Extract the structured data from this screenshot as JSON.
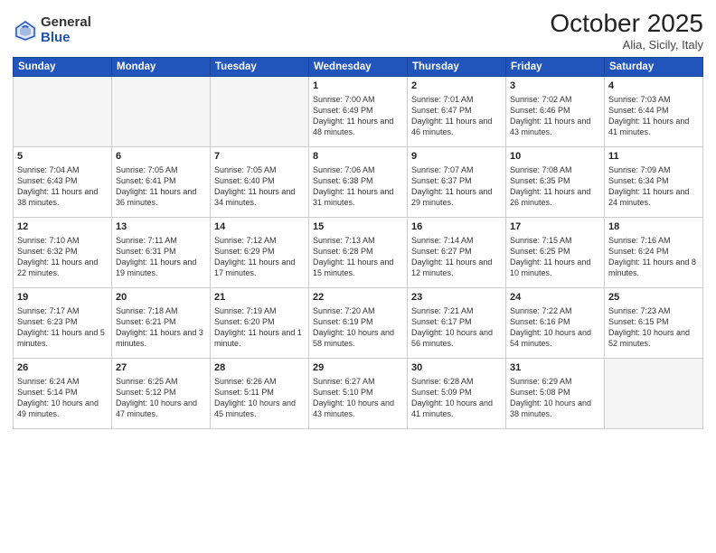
{
  "logo": {
    "general": "General",
    "blue": "Blue"
  },
  "title": "October 2025",
  "location": "Alia, Sicily, Italy",
  "days_header": [
    "Sunday",
    "Monday",
    "Tuesday",
    "Wednesday",
    "Thursday",
    "Friday",
    "Saturday"
  ],
  "weeks": [
    [
      {
        "day": "",
        "info": ""
      },
      {
        "day": "",
        "info": ""
      },
      {
        "day": "",
        "info": ""
      },
      {
        "day": "1",
        "info": "Sunrise: 7:00 AM\nSunset: 6:49 PM\nDaylight: 11 hours\nand 48 minutes."
      },
      {
        "day": "2",
        "info": "Sunrise: 7:01 AM\nSunset: 6:47 PM\nDaylight: 11 hours\nand 46 minutes."
      },
      {
        "day": "3",
        "info": "Sunrise: 7:02 AM\nSunset: 6:46 PM\nDaylight: 11 hours\nand 43 minutes."
      },
      {
        "day": "4",
        "info": "Sunrise: 7:03 AM\nSunset: 6:44 PM\nDaylight: 11 hours\nand 41 minutes."
      }
    ],
    [
      {
        "day": "5",
        "info": "Sunrise: 7:04 AM\nSunset: 6:43 PM\nDaylight: 11 hours\nand 38 minutes."
      },
      {
        "day": "6",
        "info": "Sunrise: 7:05 AM\nSunset: 6:41 PM\nDaylight: 11 hours\nand 36 minutes."
      },
      {
        "day": "7",
        "info": "Sunrise: 7:05 AM\nSunset: 6:40 PM\nDaylight: 11 hours\nand 34 minutes."
      },
      {
        "day": "8",
        "info": "Sunrise: 7:06 AM\nSunset: 6:38 PM\nDaylight: 11 hours\nand 31 minutes."
      },
      {
        "day": "9",
        "info": "Sunrise: 7:07 AM\nSunset: 6:37 PM\nDaylight: 11 hours\nand 29 minutes."
      },
      {
        "day": "10",
        "info": "Sunrise: 7:08 AM\nSunset: 6:35 PM\nDaylight: 11 hours\nand 26 minutes."
      },
      {
        "day": "11",
        "info": "Sunrise: 7:09 AM\nSunset: 6:34 PM\nDaylight: 11 hours\nand 24 minutes."
      }
    ],
    [
      {
        "day": "12",
        "info": "Sunrise: 7:10 AM\nSunset: 6:32 PM\nDaylight: 11 hours\nand 22 minutes."
      },
      {
        "day": "13",
        "info": "Sunrise: 7:11 AM\nSunset: 6:31 PM\nDaylight: 11 hours\nand 19 minutes."
      },
      {
        "day": "14",
        "info": "Sunrise: 7:12 AM\nSunset: 6:29 PM\nDaylight: 11 hours\nand 17 minutes."
      },
      {
        "day": "15",
        "info": "Sunrise: 7:13 AM\nSunset: 6:28 PM\nDaylight: 11 hours\nand 15 minutes."
      },
      {
        "day": "16",
        "info": "Sunrise: 7:14 AM\nSunset: 6:27 PM\nDaylight: 11 hours\nand 12 minutes."
      },
      {
        "day": "17",
        "info": "Sunrise: 7:15 AM\nSunset: 6:25 PM\nDaylight: 11 hours\nand 10 minutes."
      },
      {
        "day": "18",
        "info": "Sunrise: 7:16 AM\nSunset: 6:24 PM\nDaylight: 11 hours\nand 8 minutes."
      }
    ],
    [
      {
        "day": "19",
        "info": "Sunrise: 7:17 AM\nSunset: 6:23 PM\nDaylight: 11 hours\nand 5 minutes."
      },
      {
        "day": "20",
        "info": "Sunrise: 7:18 AM\nSunset: 6:21 PM\nDaylight: 11 hours\nand 3 minutes."
      },
      {
        "day": "21",
        "info": "Sunrise: 7:19 AM\nSunset: 6:20 PM\nDaylight: 11 hours\nand 1 minute."
      },
      {
        "day": "22",
        "info": "Sunrise: 7:20 AM\nSunset: 6:19 PM\nDaylight: 10 hours\nand 58 minutes."
      },
      {
        "day": "23",
        "info": "Sunrise: 7:21 AM\nSunset: 6:17 PM\nDaylight: 10 hours\nand 56 minutes."
      },
      {
        "day": "24",
        "info": "Sunrise: 7:22 AM\nSunset: 6:16 PM\nDaylight: 10 hours\nand 54 minutes."
      },
      {
        "day": "25",
        "info": "Sunrise: 7:23 AM\nSunset: 6:15 PM\nDaylight: 10 hours\nand 52 minutes."
      }
    ],
    [
      {
        "day": "26",
        "info": "Sunrise: 6:24 AM\nSunset: 5:14 PM\nDaylight: 10 hours\nand 49 minutes."
      },
      {
        "day": "27",
        "info": "Sunrise: 6:25 AM\nSunset: 5:12 PM\nDaylight: 10 hours\nand 47 minutes."
      },
      {
        "day": "28",
        "info": "Sunrise: 6:26 AM\nSunset: 5:11 PM\nDaylight: 10 hours\nand 45 minutes."
      },
      {
        "day": "29",
        "info": "Sunrise: 6:27 AM\nSunset: 5:10 PM\nDaylight: 10 hours\nand 43 minutes."
      },
      {
        "day": "30",
        "info": "Sunrise: 6:28 AM\nSunset: 5:09 PM\nDaylight: 10 hours\nand 41 minutes."
      },
      {
        "day": "31",
        "info": "Sunrise: 6:29 AM\nSunset: 5:08 PM\nDaylight: 10 hours\nand 38 minutes."
      },
      {
        "day": "",
        "info": ""
      }
    ]
  ]
}
